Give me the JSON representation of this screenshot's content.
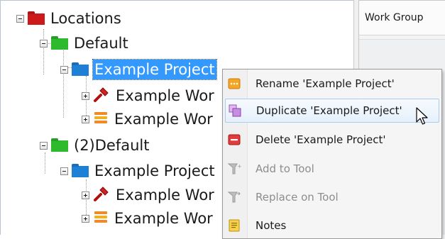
{
  "tree": {
    "root_label": "Locations",
    "default_label": "Default",
    "project_label": "Example Project",
    "work_label_1": "Example Wor",
    "work_label_2": "Example Wor",
    "default2_label": "(2)Default",
    "project2_label": "Example Project",
    "work2_label_1": "Example Wor",
    "work2_label_2": "Example Wor"
  },
  "grid": {
    "column_header": "Work Group"
  },
  "context_menu": {
    "items": [
      {
        "label": "Rename 'Example Project'",
        "icon": "rename-icon",
        "enabled": true
      },
      {
        "label": "Duplicate 'Example Project'",
        "icon": "duplicate-icon",
        "enabled": true,
        "hovered": true
      },
      {
        "label": "Delete 'Example Project'",
        "icon": "delete-icon",
        "enabled": true
      },
      {
        "label": "Add to Tool",
        "icon": "add-to-tool-icon",
        "enabled": false
      },
      {
        "label": "Replace on Tool",
        "icon": "replace-on-tool-icon",
        "enabled": false
      },
      {
        "label": "Notes",
        "icon": "notes-icon",
        "enabled": true
      }
    ]
  },
  "colors": {
    "selection": "#3399ff",
    "folder_red": "#cc1a1a",
    "folder_green": "#2dbb2d",
    "folder_blue": "#1e7fd6"
  }
}
